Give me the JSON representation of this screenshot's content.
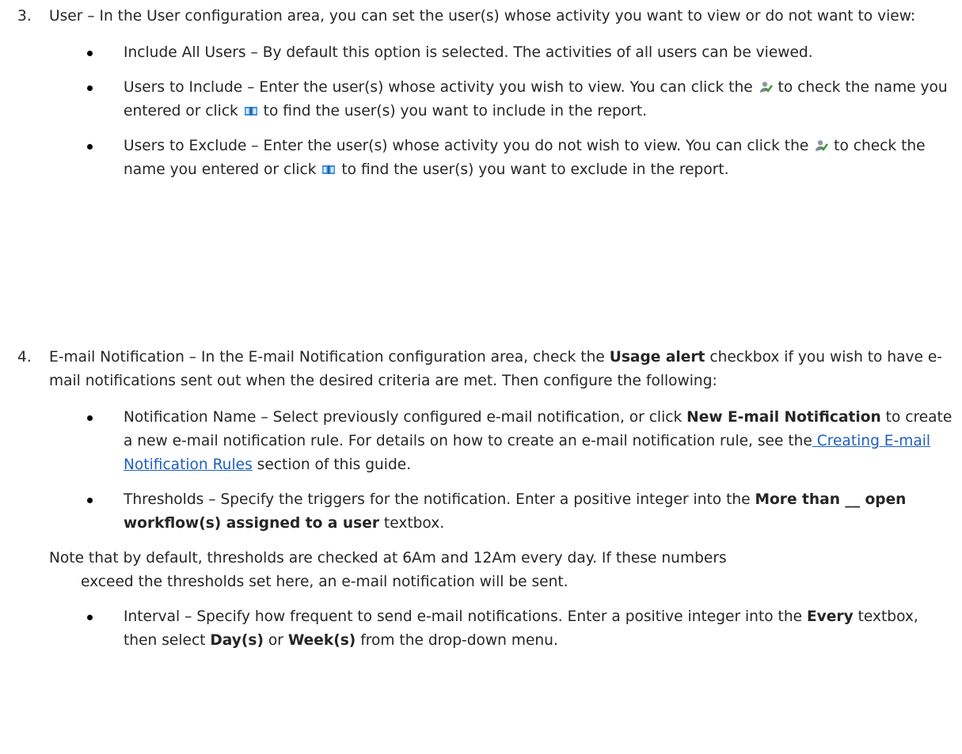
{
  "items": [
    {
      "number": "3.",
      "intro": "User – In the User configuration area, you can set the user(s) whose activity you want to view or do not want to view:",
      "bullets": [
        {
          "text": "Include All Users – By default this option is selected. The activities of all users can be viewed."
        },
        {
          "a": "Users to Include – Enter the user(s) whose activity you wish to view. You can click the",
          "b": " to check the name you entered or click ",
          "c": " to find the user(s) you want to include in the report."
        },
        {
          "a": "Users to Exclude – Enter the user(s) whose activity you do not wish to view. You can click the",
          "b": " to check the name you entered or click ",
          "c": " to find the user(s) you want to exclude in the report."
        }
      ]
    },
    {
      "number": "4.",
      "intro_a": "E-mail Notification – In the E-mail Notification configuration area, check the ",
      "intro_bold": "Usage alert",
      "intro_b": " checkbox if you wish to have e-mail notifications sent out when the desired criteria are met. Then configure the following:",
      "notification_name": {
        "a": "Notification Name – Select previously configured e-mail notification, or click ",
        "bold": "New E-mail Notification",
        "b": " to create a new e-mail notification rule. For details on how to create an e-mail notification rule, see the",
        "link": " Creating E-mail Notification Rules",
        "c": " section of this guide."
      },
      "thresholds": {
        "a": "Thresholds – Specify the triggers for the notification. Enter a positive integer into the ",
        "bold": "More than __ open workflow(s) assigned to a user",
        "b": " textbox."
      },
      "note": {
        "line1": "Note that by default, thresholds are checked at 6Am and 12Am every day. If these numbers",
        "line2": "exceed the thresholds set here, an e-mail notification will be sent."
      },
      "interval": {
        "a": "Interval – Specify how frequent to send e-mail notifications. Enter a positive integer into the ",
        "bold1": "Every",
        "b": " textbox, then select ",
        "bold2": "Day(s)",
        "c": " or ",
        "bold3": "Week(s)",
        "d": " from the drop-down menu."
      }
    }
  ],
  "icons": {
    "check_user": "user-check-icon",
    "address_book": "address-book-icon"
  }
}
